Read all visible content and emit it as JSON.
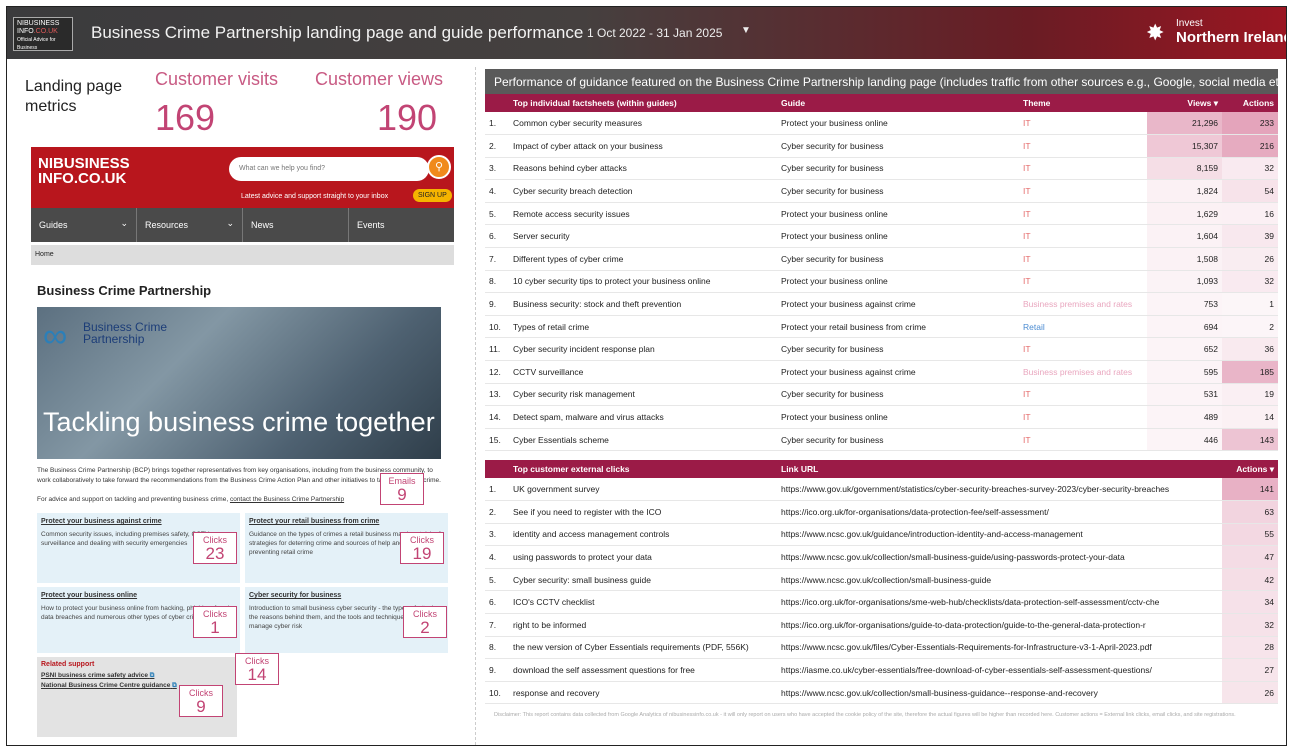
{
  "header": {
    "logo_line1": "NIBUSINESS",
    "logo_line2": "INFO",
    "logo_line2b": ".CO.UK",
    "logo_line3": "Official Advice for Business",
    "title": "Business Crime Partnership landing page and guide performance",
    "date_range": "1 Oct 2022 - 31 Jan 2025",
    "brand_small": "Invest",
    "brand_large": "Northern Ireland"
  },
  "metrics": {
    "label": "Landing page metrics",
    "visits_title": "Customer visits",
    "visits_value": "169",
    "views_title": "Customer views",
    "views_value": "190"
  },
  "site": {
    "logo_a": "NIBUSINESS",
    "logo_b": "INFO.CO.UK",
    "search_placeholder": "What can we help you find?",
    "advice": "Latest advice and support straight to your inbox",
    "signup": "SIGN UP",
    "nav": [
      "Guides",
      "Resources",
      "News",
      "Events"
    ],
    "crumb": "Home",
    "heading": "Business Crime Partnership",
    "hero_logo_line1": "Business Crime",
    "hero_logo_line2": "Partnership",
    "hero_text": "Tackling business crime together",
    "intro": "The Business Crime Partnership (BCP) brings together representatives from key organisations, including from the business community, to work collaboratively to take forward the recommendations from the Business Crime Action Plan and other initiatives to tackle business crime.",
    "contact_prefix": "For advice and support on tackling and preventing business crime, ",
    "contact_link": "contact the Business Crime Partnership",
    "cards": [
      {
        "title": "Protect your business against crime",
        "body": "Common security issues, including premises safety, CCTV surveillance and dealing with security emergencies"
      },
      {
        "title": "Protect your retail business from crime",
        "body": "Guidance on the types of crimes a retail business may be at risk of, strategies for deterring crime and sources of help and support for preventing retail crime"
      },
      {
        "title": "Protect your business online",
        "body": "How to protect your business online from hacking, phishing, fraud, data breaches and numerous other types of cyber crime"
      },
      {
        "title": "Cyber security for business",
        "body": "Introduction to small business cyber security - the types of attacks, the reasons behind them, and the tools and techniques to help you manage cyber risk"
      }
    ],
    "related_title": "Related support",
    "related_links": [
      "PSNI business crime safety advice",
      "National Business Crime Centre guidance"
    ]
  },
  "callouts": {
    "emails_label": "Emails",
    "emails_value": "9",
    "c1_label": "Clicks",
    "c1_value": "23",
    "c2_label": "Clicks",
    "c2_value": "19",
    "c3_label": "Clicks",
    "c3_value": "1",
    "c4_label": "Clicks",
    "c4_value": "2",
    "c5_label": "Clicks",
    "c5_value": "14",
    "c6_label": "Clicks",
    "c6_value": "9"
  },
  "guides": {
    "header": "Performance of guidance featured on the Business Crime Partnership landing page (includes traffic from other sources e.g., Google, social media etc.)",
    "columns": [
      "Top individual factsheets (within guides)",
      "Guide",
      "Theme",
      "Views ▾",
      "Actions"
    ],
    "rows": [
      {
        "n": "1.",
        "f": "Common cyber security measures",
        "g": "Protect your business online",
        "t": "IT",
        "v": "21,296",
        "a": "233"
      },
      {
        "n": "2.",
        "f": "Impact of cyber attack on your business",
        "g": "Cyber security for business",
        "t": "IT",
        "v": "15,307",
        "a": "216"
      },
      {
        "n": "3.",
        "f": "Reasons behind cyber attacks",
        "g": "Cyber security for business",
        "t": "IT",
        "v": "8,159",
        "a": "32"
      },
      {
        "n": "4.",
        "f": "Cyber security breach detection",
        "g": "Cyber security for business",
        "t": "IT",
        "v": "1,824",
        "a": "54"
      },
      {
        "n": "5.",
        "f": "Remote access security issues",
        "g": "Protect your business online",
        "t": "IT",
        "v": "1,629",
        "a": "16"
      },
      {
        "n": "6.",
        "f": "Server security",
        "g": "Protect your business online",
        "t": "IT",
        "v": "1,604",
        "a": "39"
      },
      {
        "n": "7.",
        "f": "Different types of cyber crime",
        "g": "Cyber security for business",
        "t": "IT",
        "v": "1,508",
        "a": "26"
      },
      {
        "n": "8.",
        "f": "10 cyber security tips to protect your business online",
        "g": "Protect your business online",
        "t": "IT",
        "v": "1,093",
        "a": "32"
      },
      {
        "n": "9.",
        "f": "Business security: stock and theft prevention",
        "g": "Protect your business against crime",
        "t": "Business premises and rates",
        "v": "753",
        "a": "1"
      },
      {
        "n": "10.",
        "f": "Types of retail crime",
        "g": "Protect your retail business from crime",
        "t": "Retail",
        "v": "694",
        "a": "2"
      },
      {
        "n": "11.",
        "f": "Cyber security incident response plan",
        "g": "Cyber security for business",
        "t": "IT",
        "v": "652",
        "a": "36"
      },
      {
        "n": "12.",
        "f": "CCTV surveillance",
        "g": "Protect your business against crime",
        "t": "Business premises and rates",
        "v": "595",
        "a": "185"
      },
      {
        "n": "13.",
        "f": "Cyber security risk management",
        "g": "Cyber security for business",
        "t": "IT",
        "v": "531",
        "a": "19"
      },
      {
        "n": "14.",
        "f": "Detect spam, malware and virus attacks",
        "g": "Protect your business online",
        "t": "IT",
        "v": "489",
        "a": "14"
      },
      {
        "n": "15.",
        "f": "Cyber Essentials scheme",
        "g": "Cyber security for business",
        "t": "IT",
        "v": "446",
        "a": "143"
      }
    ]
  },
  "clicks": {
    "columns": [
      "Top customer external clicks",
      "Link URL",
      "Actions ▾"
    ],
    "rows": [
      {
        "n": "1.",
        "c": "UK government survey",
        "u": "https://www.gov.uk/government/statistics/cyber-security-breaches-survey-2023/cyber-security-breaches",
        "a": "141"
      },
      {
        "n": "2.",
        "c": "See if you need to register with the ICO",
        "u": "https://ico.org.uk/for-organisations/data-protection-fee/self-assessment/",
        "a": "63"
      },
      {
        "n": "3.",
        "c": "identity and access management controls",
        "u": "https://www.ncsc.gov.uk/guidance/introduction-identity-and-access-management",
        "a": "55"
      },
      {
        "n": "4.",
        "c": "using passwords to protect your data",
        "u": "https://www.ncsc.gov.uk/collection/small-business-guide/using-passwords-protect-your-data",
        "a": "47"
      },
      {
        "n": "5.",
        "c": "Cyber security: small business guide",
        "u": "https://www.ncsc.gov.uk/collection/small-business-guide",
        "a": "42"
      },
      {
        "n": "6.",
        "c": "ICO's CCTV checklist",
        "u": "https://ico.org.uk/for-organisations/sme-web-hub/checklists/data-protection-self-assessment/cctv-che",
        "a": "34"
      },
      {
        "n": "7.",
        "c": "right to be informed",
        "u": "https://ico.org.uk/for-organisations/guide-to-data-protection/guide-to-the-general-data-protection-r",
        "a": "32"
      },
      {
        "n": "8.",
        "c": "the new version of Cyber Essentials requirements (PDF, 556K)",
        "u": "https://www.ncsc.gov.uk/files/Cyber-Essentials-Requirements-for-Infrastructure-v3-1-April-2023.pdf",
        "a": "28"
      },
      {
        "n": "9.",
        "c": "download the self assessment questions for free",
        "u": "https://iasme.co.uk/cyber-essentials/free-download-of-cyber-essentials-self-assessment-questions/",
        "a": "27"
      },
      {
        "n": "10.",
        "c": "response and recovery",
        "u": "https://www.ncsc.gov.uk/collection/small-business-guidance--response-and-recovery",
        "a": "26"
      }
    ]
  },
  "disclaimer": "Disclaimer: This report contains data collected from Google Analytics of nibusinessinfo.co.uk - it will only report on users who have accepted the cookie policy of the site, therefore the actual figures will be higher than recorded here. Customer actions = External link clicks, email clicks, and site registrations.",
  "colors": {
    "accent": "#9b1b47",
    "metric": "#c24474",
    "header_dark": "#3b3b3d",
    "brand_red": "#b8161d"
  }
}
